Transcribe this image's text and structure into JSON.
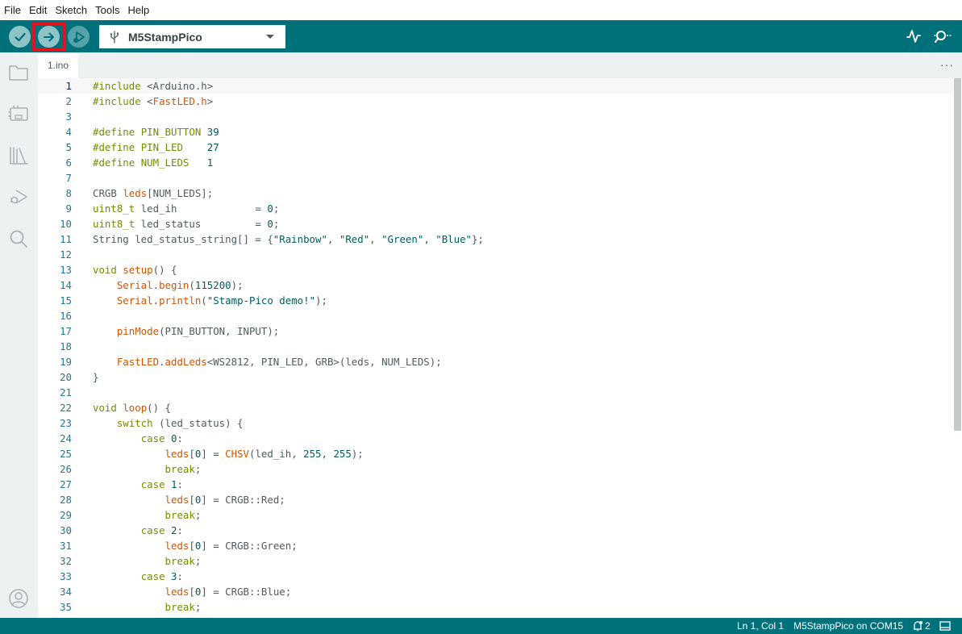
{
  "menu": [
    "File",
    "Edit",
    "Sketch",
    "Tools",
    "Help"
  ],
  "toolbar": {
    "board": "M5StampPico",
    "colors": {
      "bar": "#00717a",
      "highlight": "#e0141e"
    }
  },
  "sidebar": {
    "icons": [
      "folder-icon",
      "board-manager-icon",
      "library-icon",
      "debug-icon",
      "search-icon",
      "account-icon"
    ]
  },
  "tabs": [
    {
      "label": "1.ino",
      "active": true
    }
  ],
  "editor": {
    "current_line": 1,
    "lines": [
      {
        "n": "1",
        "text": "#include <Arduino.h>"
      },
      {
        "n": "2",
        "text": "#include <FastLED.h>"
      },
      {
        "n": "3",
        "text": ""
      },
      {
        "n": "4",
        "text": "#define PIN_BUTTON 39"
      },
      {
        "n": "5",
        "text": "#define PIN_LED    27"
      },
      {
        "n": "6",
        "text": "#define NUM_LEDS   1"
      },
      {
        "n": "7",
        "text": ""
      },
      {
        "n": "8",
        "text": "CRGB leds[NUM_LEDS];"
      },
      {
        "n": "9",
        "text": "uint8_t led_ih             = 0;"
      },
      {
        "n": "10",
        "text": "uint8_t led_status         = 0;"
      },
      {
        "n": "11",
        "text": "String led_status_string[] = {\"Rainbow\", \"Red\", \"Green\", \"Blue\"};"
      },
      {
        "n": "12",
        "text": ""
      },
      {
        "n": "13",
        "text": "void setup() {"
      },
      {
        "n": "14",
        "text": "    Serial.begin(115200);"
      },
      {
        "n": "15",
        "text": "    Serial.println(\"Stamp-Pico demo!\");"
      },
      {
        "n": "16",
        "text": ""
      },
      {
        "n": "17",
        "text": "    pinMode(PIN_BUTTON, INPUT);"
      },
      {
        "n": "18",
        "text": ""
      },
      {
        "n": "19",
        "text": "    FastLED.addLeds<WS2812, PIN_LED, GRB>(leds, NUM_LEDS);"
      },
      {
        "n": "20",
        "text": "}"
      },
      {
        "n": "21",
        "text": ""
      },
      {
        "n": "22",
        "text": "void loop() {"
      },
      {
        "n": "23",
        "text": "    switch (led_status) {"
      },
      {
        "n": "24",
        "text": "        case 0:"
      },
      {
        "n": "25",
        "text": "            leds[0] = CHSV(led_ih, 255, 255);"
      },
      {
        "n": "26",
        "text": "            break;"
      },
      {
        "n": "27",
        "text": "        case 1:"
      },
      {
        "n": "28",
        "text": "            leds[0] = CRGB::Red;"
      },
      {
        "n": "29",
        "text": "            break;"
      },
      {
        "n": "30",
        "text": "        case 2:"
      },
      {
        "n": "31",
        "text": "            leds[0] = CRGB::Green;"
      },
      {
        "n": "32",
        "text": "            break;"
      },
      {
        "n": "33",
        "text": "        case 3:"
      },
      {
        "n": "34",
        "text": "            leds[0] = CRGB::Blue;"
      },
      {
        "n": "35",
        "text": "            break;"
      }
    ]
  },
  "status": {
    "position": "Ln 1, Col 1",
    "board_port": "M5StampPico on COM15",
    "notifications": "2"
  }
}
